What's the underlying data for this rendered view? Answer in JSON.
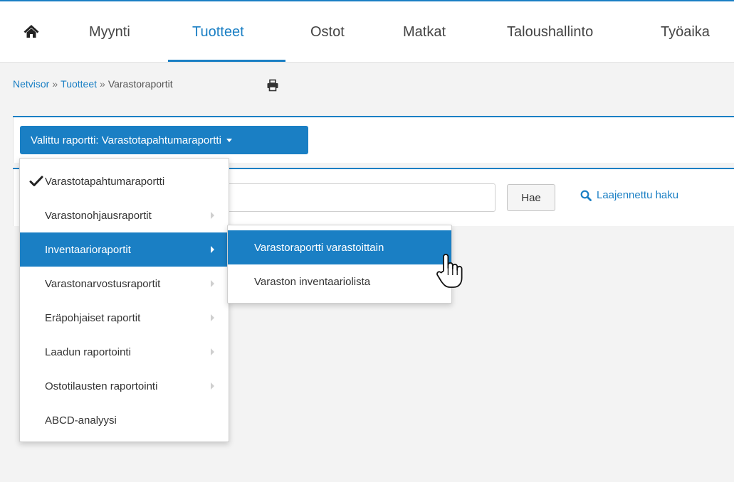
{
  "colors": {
    "accent": "#1a7fc4",
    "background": "#f3f3f3",
    "panel": "#ffffff"
  },
  "topnav": {
    "home_icon": "home-icon",
    "items": [
      {
        "label": "Myynti"
      },
      {
        "label": "Tuotteet",
        "active": true
      },
      {
        "label": "Ostot"
      },
      {
        "label": "Matkat"
      },
      {
        "label": "Taloushallinto"
      },
      {
        "label": "Työaika"
      }
    ]
  },
  "breadcrumb": {
    "items": [
      "Netvisor",
      "Tuotteet",
      "Varastoraportit"
    ],
    "separator": "»",
    "print_icon": "print-icon"
  },
  "report_selector": {
    "label": "Valittu raportti: Varastotapahtumaraportti"
  },
  "search": {
    "value": "",
    "button_label": "Hae",
    "advanced_label": "Laajennettu haku",
    "advanced_icon": "search-icon"
  },
  "menu": {
    "items": [
      {
        "label": "Varastotapahtumaraportti",
        "checked": true
      },
      {
        "label": "Varastonohjausraportit",
        "has_submenu": true
      },
      {
        "label": "Inventaarioraportit",
        "has_submenu": true,
        "active": true
      },
      {
        "label": "Varastonarvostusraportit",
        "has_submenu": true
      },
      {
        "label": "Eräpohjaiset raportit",
        "has_submenu": true
      },
      {
        "label": "Laadun raportointi",
        "has_submenu": true
      },
      {
        "label": "Ostotilausten raportointi",
        "has_submenu": true
      },
      {
        "label": "ABCD-analyysi"
      }
    ]
  },
  "submenu": {
    "items": [
      {
        "label": "Varastoraportti varastoittain",
        "active": true
      },
      {
        "label": "Varaston inventaariolista"
      }
    ]
  }
}
